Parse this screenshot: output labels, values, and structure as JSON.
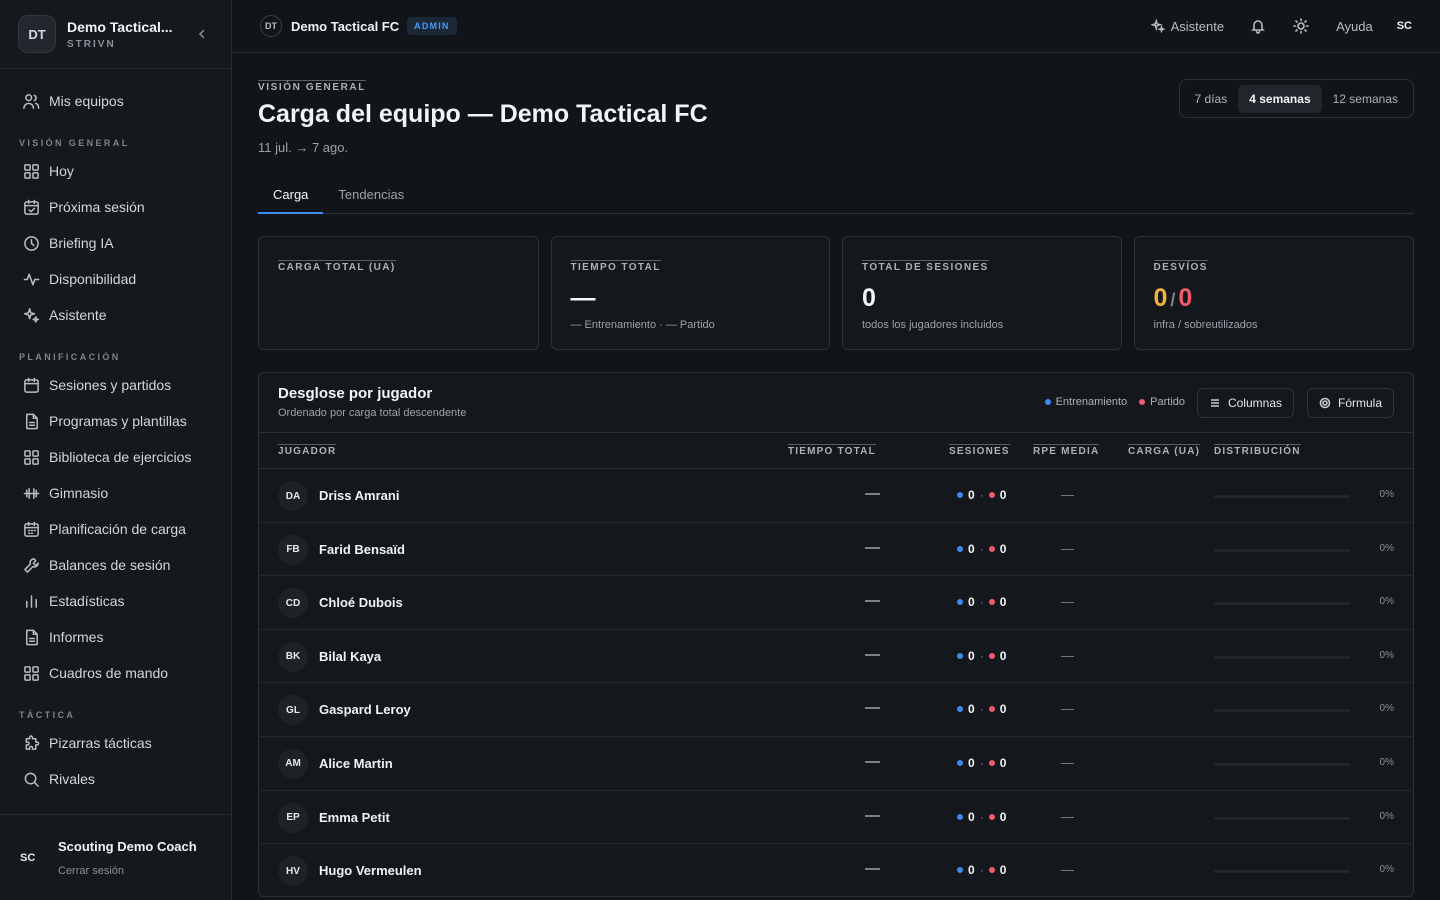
{
  "workspace": {
    "initials": "DT",
    "name": "Demo Tactical...",
    "brand": "STRIVN"
  },
  "sidebar": {
    "top_item": {
      "label": "Mis equipos",
      "icon": "users-icon"
    },
    "sections": [
      {
        "title": "VISIÓN GENERAL",
        "items": [
          {
            "label": "Hoy",
            "icon": "grid-icon"
          },
          {
            "label": "Próxima sesión",
            "icon": "calendar-check-icon"
          },
          {
            "label": "Briefing IA",
            "icon": "clock-icon"
          },
          {
            "label": "Disponibilidad",
            "icon": "activity-icon"
          },
          {
            "label": "Asistente",
            "icon": "sparkles-icon"
          }
        ]
      },
      {
        "title": "PLANIFICACIÓN",
        "items": [
          {
            "label": "Sesiones y partidos",
            "icon": "calendar-icon"
          },
          {
            "label": "Programas y plantillas",
            "icon": "document-icon"
          },
          {
            "label": "Biblioteca de ejercicios",
            "icon": "grid-icon"
          },
          {
            "label": "Gimnasio",
            "icon": "dumbbell-icon"
          },
          {
            "label": "Planificación de carga",
            "icon": "calendar-grid-icon"
          },
          {
            "label": "Balances de sesión",
            "icon": "wrench-icon"
          },
          {
            "label": "Estadísticas",
            "icon": "bar-chart-icon"
          },
          {
            "label": "Informes",
            "icon": "document-icon"
          },
          {
            "label": "Cuadros de mando",
            "icon": "grid-icon"
          }
        ]
      },
      {
        "title": "TÁCTICA",
        "items": [
          {
            "label": "Pizarras tácticas",
            "icon": "puzzle-icon"
          },
          {
            "label": "Rivales",
            "icon": "search-icon"
          }
        ]
      }
    ]
  },
  "user": {
    "initials": "SC",
    "name": "Scouting Demo Coach",
    "logout": "Cerrar sesión"
  },
  "topbar": {
    "team_initials": "DT",
    "team_name": "Demo Tactical FC",
    "role_badge": "ADMIN",
    "assistant": "Asistente",
    "help": "Ayuda",
    "user_initials": "SC"
  },
  "page": {
    "eyebrow": "VISIÓN GENERAL",
    "title": "Carga del equipo — Demo Tactical FC",
    "date_range": "11 jul. → 7 ago.",
    "ranges": [
      "7 días",
      "4 semanas",
      "12 semanas"
    ],
    "active_range": "4 semanas",
    "tabs": [
      "Carga",
      "Tendencias"
    ],
    "active_tab": "Carga"
  },
  "kpis": {
    "total_load": {
      "label": "CARGA TOTAL (UA)",
      "value": ""
    },
    "total_time": {
      "label": "TIEMPO TOTAL",
      "value": "—",
      "sub": "— Entrenamiento · — Partido"
    },
    "total_sessions": {
      "label": "TOTAL DE SESIONES",
      "value": "0",
      "sub": "todos los jugadores incluidos"
    },
    "deviations": {
      "label": "DESVÍOS",
      "under": "0",
      "slash": "/",
      "over": "0",
      "sub": "infra / sobreutilizados"
    }
  },
  "breakdown": {
    "title": "Desglose por jugador",
    "subtitle": "Ordenado por carga total descendente",
    "legend": {
      "training": "Entrenamiento",
      "match": "Partido"
    },
    "columns_button": "Columnas",
    "formula_button": "Fórmula",
    "headers": {
      "player": "JUGADOR",
      "total_time": "TIEMPO TOTAL",
      "sessions": "SESIONES",
      "rpe": "RPE MEDIA",
      "load": "CARGA (UA)",
      "distribution": "DISTRIBUCIÓN"
    },
    "rows": [
      {
        "initials": "DA",
        "name": "Driss Amrani",
        "time": "—",
        "training_sessions": "0",
        "match_sessions": "0",
        "sessions_sep": "·",
        "rpe": "—",
        "load": "",
        "distribution": 0,
        "distribution_label": "0%"
      },
      {
        "initials": "FB",
        "name": "Farid Bensaïd",
        "time": "—",
        "training_sessions": "0",
        "match_sessions": "0",
        "sessions_sep": "·",
        "rpe": "—",
        "load": "",
        "distribution": 0,
        "distribution_label": "0%"
      },
      {
        "initials": "CD",
        "name": "Chloé Dubois",
        "time": "—",
        "training_sessions": "0",
        "match_sessions": "0",
        "sessions_sep": "·",
        "rpe": "—",
        "load": "",
        "distribution": 0,
        "distribution_label": "0%"
      },
      {
        "initials": "BK",
        "name": "Bilal Kaya",
        "time": "—",
        "training_sessions": "0",
        "match_sessions": "0",
        "sessions_sep": "·",
        "rpe": "—",
        "load": "",
        "distribution": 0,
        "distribution_label": "0%"
      },
      {
        "initials": "GL",
        "name": "Gaspard Leroy",
        "time": "—",
        "training_sessions": "0",
        "match_sessions": "0",
        "sessions_sep": "·",
        "rpe": "—",
        "load": "",
        "distribution": 0,
        "distribution_label": "0%"
      },
      {
        "initials": "AM",
        "name": "Alice Martin",
        "time": "—",
        "training_sessions": "0",
        "match_sessions": "0",
        "sessions_sep": "·",
        "rpe": "—",
        "load": "",
        "distribution": 0,
        "distribution_label": "0%"
      },
      {
        "initials": "EP",
        "name": "Emma Petit",
        "time": "—",
        "training_sessions": "0",
        "match_sessions": "0",
        "sessions_sep": "·",
        "rpe": "—",
        "load": "",
        "distribution": 0,
        "distribution_label": "0%"
      },
      {
        "initials": "HV",
        "name": "Hugo Vermeulen",
        "time": "—",
        "training_sessions": "0",
        "match_sessions": "0",
        "sessions_sep": "·",
        "rpe": "—",
        "load": "",
        "distribution": 0,
        "distribution_label": "0%"
      }
    ]
  },
  "colors": {
    "accent": "#3d8bf0",
    "match": "#ef5b6b",
    "warning": "#f0b43c",
    "background": "#111418"
  }
}
